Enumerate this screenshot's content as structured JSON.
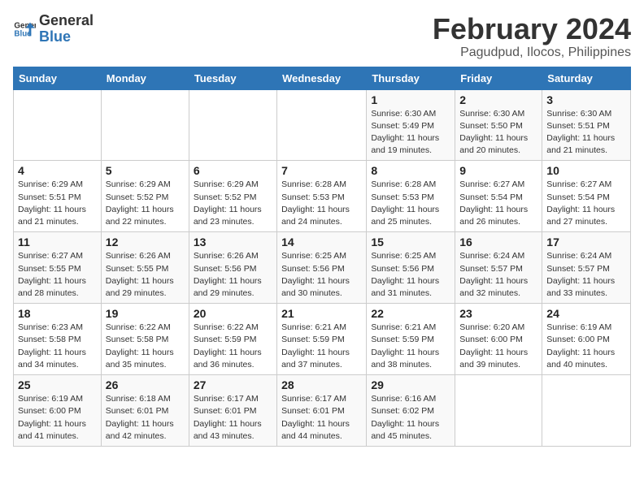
{
  "header": {
    "logo_line1": "General",
    "logo_line2": "Blue",
    "title": "February 2024",
    "subtitle": "Pagudpud, Ilocos, Philippines"
  },
  "days_of_week": [
    "Sunday",
    "Monday",
    "Tuesday",
    "Wednesday",
    "Thursday",
    "Friday",
    "Saturday"
  ],
  "weeks": [
    [
      {
        "day": "",
        "info": ""
      },
      {
        "day": "",
        "info": ""
      },
      {
        "day": "",
        "info": ""
      },
      {
        "day": "",
        "info": ""
      },
      {
        "day": "1",
        "info": "Sunrise: 6:30 AM\nSunset: 5:49 PM\nDaylight: 11 hours and 19 minutes."
      },
      {
        "day": "2",
        "info": "Sunrise: 6:30 AM\nSunset: 5:50 PM\nDaylight: 11 hours and 20 minutes."
      },
      {
        "day": "3",
        "info": "Sunrise: 6:30 AM\nSunset: 5:51 PM\nDaylight: 11 hours and 21 minutes."
      }
    ],
    [
      {
        "day": "4",
        "info": "Sunrise: 6:29 AM\nSunset: 5:51 PM\nDaylight: 11 hours and 21 minutes."
      },
      {
        "day": "5",
        "info": "Sunrise: 6:29 AM\nSunset: 5:52 PM\nDaylight: 11 hours and 22 minutes."
      },
      {
        "day": "6",
        "info": "Sunrise: 6:29 AM\nSunset: 5:52 PM\nDaylight: 11 hours and 23 minutes."
      },
      {
        "day": "7",
        "info": "Sunrise: 6:28 AM\nSunset: 5:53 PM\nDaylight: 11 hours and 24 minutes."
      },
      {
        "day": "8",
        "info": "Sunrise: 6:28 AM\nSunset: 5:53 PM\nDaylight: 11 hours and 25 minutes."
      },
      {
        "day": "9",
        "info": "Sunrise: 6:27 AM\nSunset: 5:54 PM\nDaylight: 11 hours and 26 minutes."
      },
      {
        "day": "10",
        "info": "Sunrise: 6:27 AM\nSunset: 5:54 PM\nDaylight: 11 hours and 27 minutes."
      }
    ],
    [
      {
        "day": "11",
        "info": "Sunrise: 6:27 AM\nSunset: 5:55 PM\nDaylight: 11 hours and 28 minutes."
      },
      {
        "day": "12",
        "info": "Sunrise: 6:26 AM\nSunset: 5:55 PM\nDaylight: 11 hours and 29 minutes."
      },
      {
        "day": "13",
        "info": "Sunrise: 6:26 AM\nSunset: 5:56 PM\nDaylight: 11 hours and 29 minutes."
      },
      {
        "day": "14",
        "info": "Sunrise: 6:25 AM\nSunset: 5:56 PM\nDaylight: 11 hours and 30 minutes."
      },
      {
        "day": "15",
        "info": "Sunrise: 6:25 AM\nSunset: 5:56 PM\nDaylight: 11 hours and 31 minutes."
      },
      {
        "day": "16",
        "info": "Sunrise: 6:24 AM\nSunset: 5:57 PM\nDaylight: 11 hours and 32 minutes."
      },
      {
        "day": "17",
        "info": "Sunrise: 6:24 AM\nSunset: 5:57 PM\nDaylight: 11 hours and 33 minutes."
      }
    ],
    [
      {
        "day": "18",
        "info": "Sunrise: 6:23 AM\nSunset: 5:58 PM\nDaylight: 11 hours and 34 minutes."
      },
      {
        "day": "19",
        "info": "Sunrise: 6:22 AM\nSunset: 5:58 PM\nDaylight: 11 hours and 35 minutes."
      },
      {
        "day": "20",
        "info": "Sunrise: 6:22 AM\nSunset: 5:59 PM\nDaylight: 11 hours and 36 minutes."
      },
      {
        "day": "21",
        "info": "Sunrise: 6:21 AM\nSunset: 5:59 PM\nDaylight: 11 hours and 37 minutes."
      },
      {
        "day": "22",
        "info": "Sunrise: 6:21 AM\nSunset: 5:59 PM\nDaylight: 11 hours and 38 minutes."
      },
      {
        "day": "23",
        "info": "Sunrise: 6:20 AM\nSunset: 6:00 PM\nDaylight: 11 hours and 39 minutes."
      },
      {
        "day": "24",
        "info": "Sunrise: 6:19 AM\nSunset: 6:00 PM\nDaylight: 11 hours and 40 minutes."
      }
    ],
    [
      {
        "day": "25",
        "info": "Sunrise: 6:19 AM\nSunset: 6:00 PM\nDaylight: 11 hours and 41 minutes."
      },
      {
        "day": "26",
        "info": "Sunrise: 6:18 AM\nSunset: 6:01 PM\nDaylight: 11 hours and 42 minutes."
      },
      {
        "day": "27",
        "info": "Sunrise: 6:17 AM\nSunset: 6:01 PM\nDaylight: 11 hours and 43 minutes."
      },
      {
        "day": "28",
        "info": "Sunrise: 6:17 AM\nSunset: 6:01 PM\nDaylight: 11 hours and 44 minutes."
      },
      {
        "day": "29",
        "info": "Sunrise: 6:16 AM\nSunset: 6:02 PM\nDaylight: 11 hours and 45 minutes."
      },
      {
        "day": "",
        "info": ""
      },
      {
        "day": "",
        "info": ""
      }
    ]
  ]
}
